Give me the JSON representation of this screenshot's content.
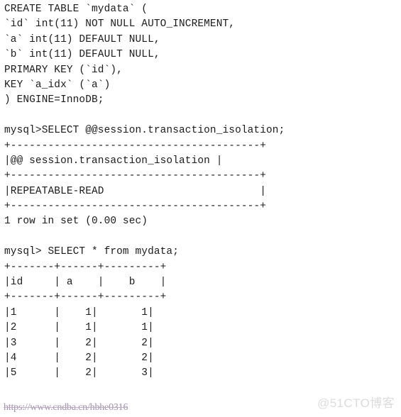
{
  "terminal": {
    "lines": [
      "CREATE TABLE `mydata` (",
      "`id` int(11) NOT NULL AUTO_INCREMENT,",
      "`a` int(11) DEFAULT NULL,",
      "`b` int(11) DEFAULT NULL,",
      "PRIMARY KEY (`id`),",
      "KEY `a_idx` (`a`)",
      ") ENGINE=InnoDB;",
      "",
      "mysql>SELECT @@session.transaction_isolation;",
      "+----------------------------------------+",
      "|@@ session.transaction_isolation |",
      "+----------------------------------------+",
      "|REPEATABLE-READ                         |",
      "+----------------------------------------+",
      "1 row in set (0.00 sec)",
      "",
      "mysql> SELECT * from mydata;",
      "+-------+------+---------+",
      "|id     | a    |    b    |",
      "+-------+------+---------+",
      "|1      |    1|       1|",
      "|2      |    1|       1|",
      "|3      |    2|       2|",
      "|4      |    2|       2|",
      "|5      |    2|       3|"
    ],
    "create_table": {
      "table_name": "mydata",
      "columns": [
        {
          "name": "id",
          "type": "int(11)",
          "attributes": "NOT NULL AUTO_INCREMENT"
        },
        {
          "name": "a",
          "type": "int(11)",
          "attributes": "DEFAULT NULL"
        },
        {
          "name": "b",
          "type": "int(11)",
          "attributes": "DEFAULT NULL"
        }
      ],
      "primary_key": "id",
      "key_name": "a_idx",
      "key_column": "a",
      "engine": "InnoDB"
    },
    "isolation_query": {
      "prompt": "mysql>",
      "statement": "SELECT @@session.transaction_isolation;",
      "column_header": "@@ session.transaction_isolation",
      "value": "REPEATABLE-READ",
      "status": "1 row in set (0.00 sec)"
    },
    "select_query": {
      "prompt": "mysql>",
      "statement": "SELECT * from mydata;",
      "headers": [
        "id",
        "a",
        "b"
      ],
      "rows": [
        [
          "1",
          "1",
          "1"
        ],
        [
          "2",
          "1",
          "1"
        ],
        [
          "3",
          "2",
          "2"
        ],
        [
          "4",
          "2",
          "2"
        ],
        [
          "5",
          "2",
          "3"
        ]
      ]
    }
  },
  "watermarks": {
    "url": "https://www.cndba.cn/hbhe0316",
    "brand": "@51CTO博客",
    "url_color": "#9a8aa8",
    "brand_color": "#dcdcdc"
  }
}
